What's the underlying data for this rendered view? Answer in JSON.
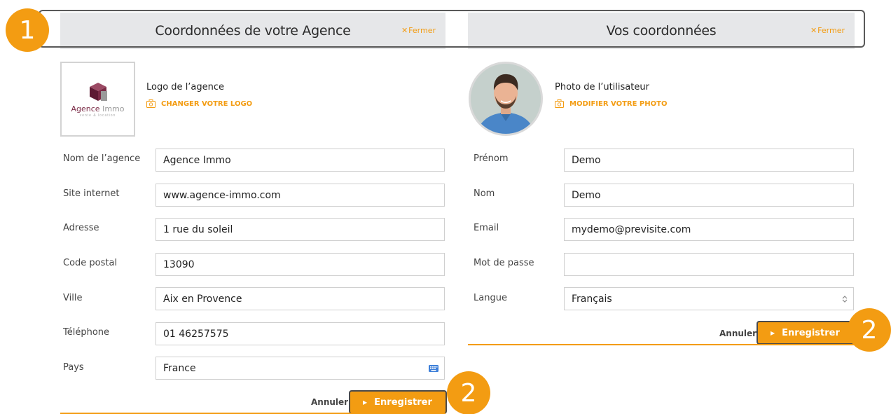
{
  "agency": {
    "header_title": "Coordonnées de votre Agence",
    "close_label": "Fermer",
    "logo": {
      "brand_main": "Agence",
      "brand_accent": "Immo",
      "brand_tagline": "vente & location",
      "title": "Logo de l’agence",
      "change_label": "CHANGER VOTRE LOGO"
    },
    "fields": [
      {
        "label": "Nom de l’agence",
        "value": "Agence Immo"
      },
      {
        "label": "Site internet",
        "value": "www.agence-immo.com"
      },
      {
        "label": "Adresse",
        "value": "1 rue du soleil"
      },
      {
        "label": "Code postal",
        "value": "13090"
      },
      {
        "label": "Ville",
        "value": "Aix en Provence"
      },
      {
        "label": "Téléphone",
        "value": "01 46257575"
      },
      {
        "label": "Pays",
        "value": "France"
      }
    ],
    "cancel_label": "Annuler",
    "save_label": "Enregistrer"
  },
  "user": {
    "header_title": "Vos coordonnées",
    "close_label": "Fermer",
    "photo": {
      "title": "Photo de l’utilisateur",
      "change_label": "MODIFIER VOTRE PHOTO"
    },
    "fields": [
      {
        "label": "Prénom",
        "value": "Demo"
      },
      {
        "label": "Nom",
        "value": "Demo"
      },
      {
        "label": "Email",
        "value": "mydemo@previsite.com"
      },
      {
        "label": "Mot de passe",
        "value": ""
      },
      {
        "label": "Langue",
        "value": "Français"
      }
    ],
    "cancel_label": "Annuler",
    "save_label": "Enregistrer"
  },
  "callouts": {
    "header": "1",
    "save_user": "2",
    "save_agency": "2"
  },
  "colors": {
    "accent": "#f39c12",
    "header_bg": "#e6e7e9",
    "brand": "#7a2a45"
  }
}
